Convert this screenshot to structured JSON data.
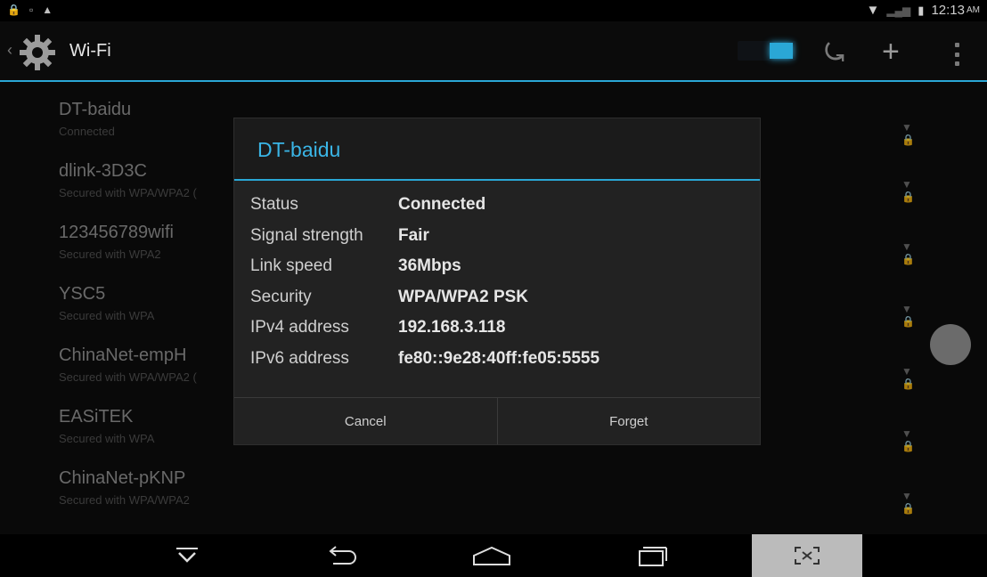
{
  "status_bar": {
    "time": "12:13",
    "ampm": "AM"
  },
  "action_bar": {
    "title": "Wi-Fi"
  },
  "networks": [
    {
      "name": "DT-baidu",
      "status": "Connected"
    },
    {
      "name": "dlink-3D3C",
      "status": "Secured with WPA/WPA2 ("
    },
    {
      "name": "123456789wifi",
      "status": "Secured with WPA2"
    },
    {
      "name": "YSC5",
      "status": "Secured with WPA"
    },
    {
      "name": "ChinaNet-empH",
      "status": "Secured with WPA/WPA2 ("
    },
    {
      "name": "EASiTEK",
      "status": "Secured with WPA"
    },
    {
      "name": "ChinaNet-pKNP",
      "status": "Secured with WPA/WPA2"
    }
  ],
  "dialog": {
    "title": "DT-baidu",
    "rows": [
      {
        "label": "Status",
        "value": "Connected"
      },
      {
        "label": "Signal strength",
        "value": "Fair"
      },
      {
        "label": "Link speed",
        "value": "36Mbps"
      },
      {
        "label": "Security",
        "value": "WPA/WPA2 PSK"
      },
      {
        "label": "IPv4 address",
        "value": "192.168.3.118"
      },
      {
        "label": "IPv6 address",
        "value": "fe80::9e28:40ff:fe05:5555"
      }
    ],
    "cancel_label": "Cancel",
    "forget_label": "Forget"
  },
  "colors": {
    "accent": "#2aa7d6"
  }
}
